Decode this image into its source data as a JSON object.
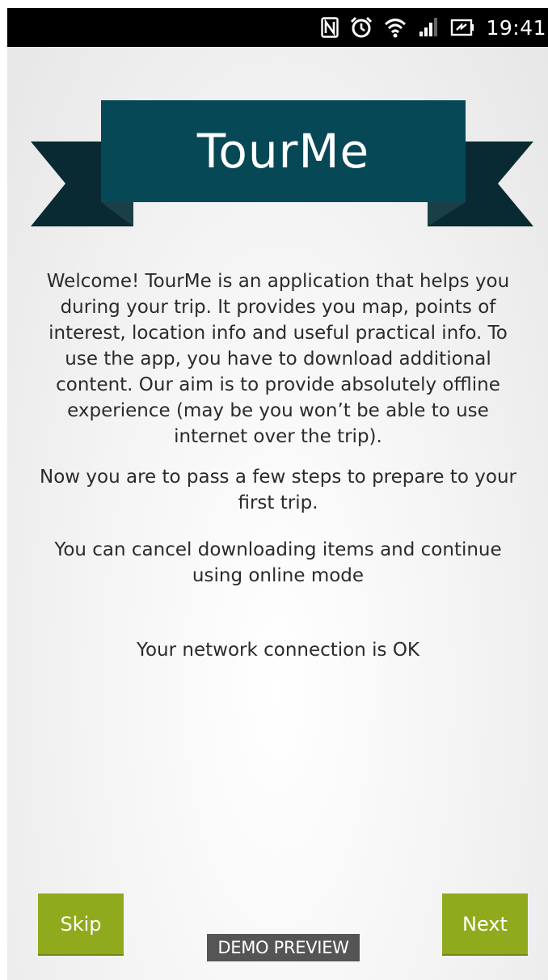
{
  "statusbar": {
    "time": "19:41",
    "icons": [
      "nfc-icon",
      "alarm-icon",
      "wifi-icon",
      "signal-icon",
      "battery-icon"
    ]
  },
  "banner": {
    "title": "TourMe",
    "colors": {
      "front": "#074857",
      "back": "#0a2a33",
      "fold": "#1a3f46"
    }
  },
  "content": {
    "welcome": "Welcome! TourMe is an application that helps you during your trip. It provides you map, points of interest, location info and useful practical info. To use the app, you have to download additional content. Our aim is to provide absolutely offline experience (may be you won’t be able to use internet over the trip).",
    "steps": "Now you are to pass a few steps to prepare to your first trip.",
    "cancel": "You can cancel downloading items and continue using online mode",
    "network_status": "Your network connection is OK"
  },
  "buttons": {
    "skip": "Skip",
    "next": "Next",
    "color": "#8fab1d"
  },
  "watermark": "DEMO PREVIEW"
}
